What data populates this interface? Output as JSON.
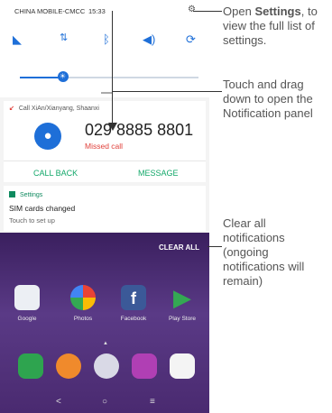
{
  "status_bar": {
    "carrier": "CHINA MOBILE-CMCC",
    "time": "15:33"
  },
  "quick_settings": {
    "icons": [
      "wifi-off-icon",
      "data-icon",
      "bluetooth-icon",
      "volume-icon",
      "rotate-icon"
    ],
    "brightness_level": 0.24
  },
  "call_notification": {
    "header": "Call",
    "location": "XiAn/Xianyang, Shaanxi",
    "number": "029 8885 8801",
    "status": "Missed call",
    "actions": [
      "CALL BACK",
      "MESSAGE"
    ]
  },
  "settings_notification": {
    "app": "Settings",
    "title": "SIM cards changed",
    "subtitle": "Touch to set up"
  },
  "home": {
    "clear_all": "CLEAR ALL",
    "apps": [
      "Google",
      "Photos",
      "Facebook",
      "Play Store"
    ],
    "nav": [
      "<",
      "○",
      "≡"
    ]
  },
  "callouts": {
    "settings_prefix": "Open",
    "settings_bold": "Settings",
    "settings_suffix": ", to view the full list of settings.",
    "drag": "Touch and drag down to open the Notification panel",
    "clear": "Clear all notifications (ongoing notifications will remain)"
  },
  "colors": {
    "accent": "#1e6fd8",
    "missed": "#e0413b",
    "action": "#13a86a"
  }
}
